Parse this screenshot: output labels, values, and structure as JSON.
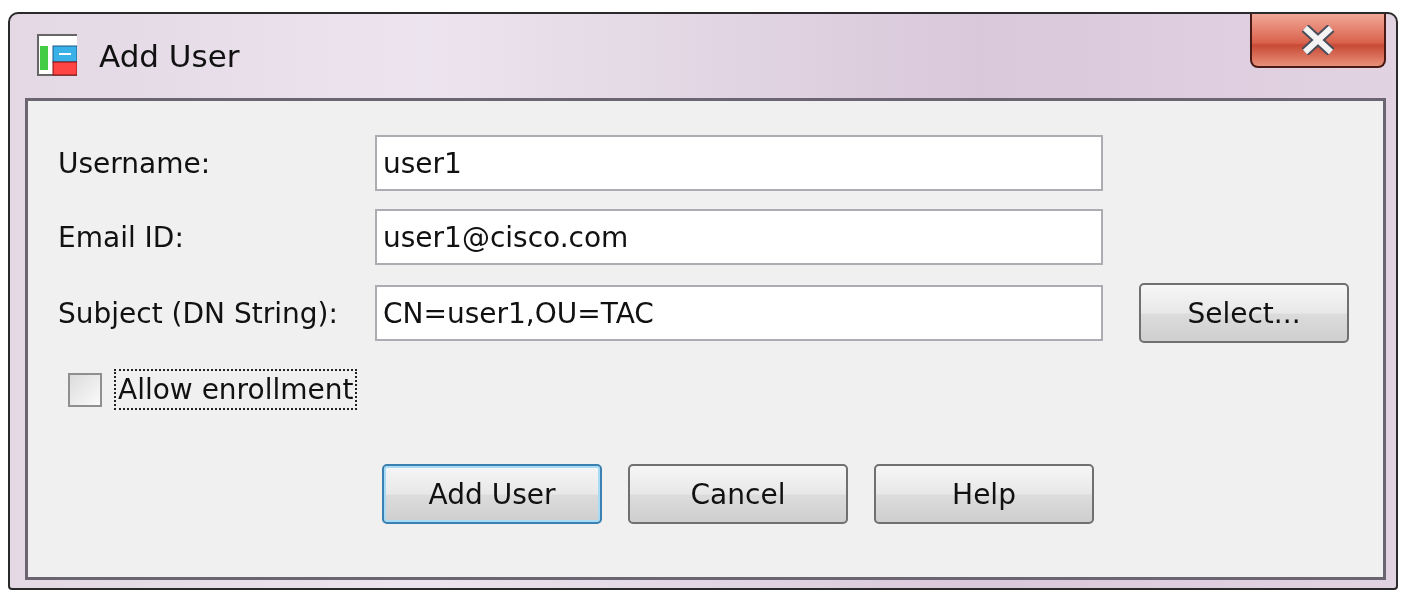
{
  "window": {
    "title": "Add User"
  },
  "fields": [
    {
      "label": "Username:",
      "value": "user1"
    },
    {
      "label": "Email ID:",
      "value": "user1@cisco.com"
    },
    {
      "label": "Subject (DN String):",
      "value": "CN=user1,OU=TAC",
      "button": "Select..."
    }
  ],
  "checkbox": {
    "label": "Allow enrollment",
    "checked": false,
    "focused": true
  },
  "buttons": [
    {
      "label": "Add User",
      "default": true
    },
    {
      "label": "Cancel",
      "default": false
    },
    {
      "label": "Help",
      "default": false
    }
  ]
}
